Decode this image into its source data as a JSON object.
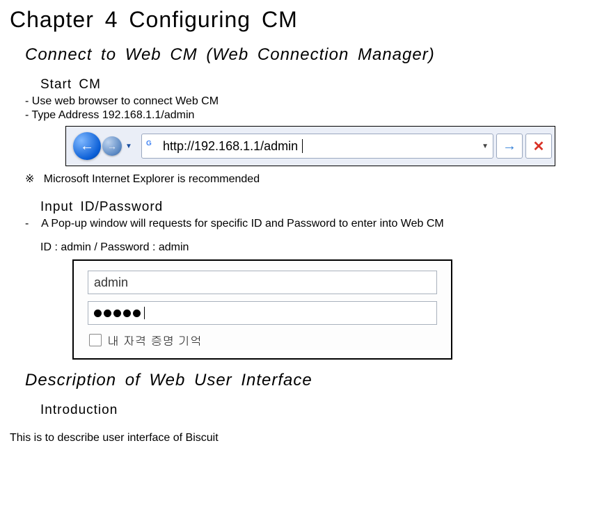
{
  "chapter_title": "Chapter  4  Configuring  CM",
  "section1": {
    "title": "Connect  to  Web  CM  (Web  Connection  Manager)",
    "start_cm": {
      "heading": "Start  CM",
      "line1": "Use web browser to connect Web CM",
      "line2": "Type Address 192.168.1.1/admin"
    },
    "addrbar": {
      "url": "http://192.168.1.1/admin"
    },
    "note_symbol": "※",
    "note": "Microsoft Internet Explorer is recommended",
    "input_id": {
      "heading": "Input  ID/Password",
      "dash": "-",
      "line": "A Pop-up window will requests for specific ID and Password to enter into Web CM",
      "creds": "ID : admin / Password : admin"
    },
    "login": {
      "username": "admin",
      "password_dots": 5,
      "remember_label": "내 자격 증명 기억"
    }
  },
  "section2": {
    "title": "Description  of  Web  User  Interface",
    "intro_heading": "Introduction",
    "intro_text": "This is to describe user interface of Biscuit"
  }
}
